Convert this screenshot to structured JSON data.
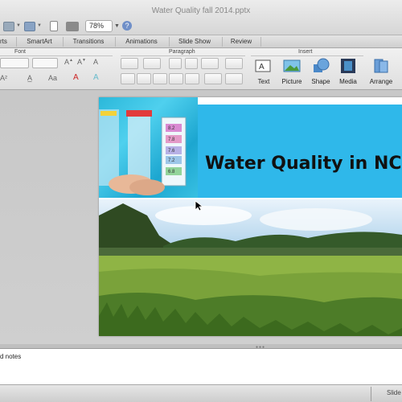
{
  "window": {
    "title": "Water Quality fall 2014.pptx",
    "zoom": "78%"
  },
  "ribbon_tabs": [
    "rts",
    "SmartArt",
    "Transitions",
    "Animations",
    "Slide Show",
    "Review"
  ],
  "ribbon_groups": {
    "font": "Font",
    "paragraph": "Paragraph",
    "insert": "Insert"
  },
  "ribbon_buttons": {
    "text": "Text",
    "picture": "Picture",
    "shape": "Shape",
    "media": "Media",
    "arrange": "Arrange"
  },
  "slide": {
    "title": "Water Quality in NC"
  },
  "test_strip_values": [
    "8.2",
    "7.8",
    "7.6",
    "7.2",
    "6.8"
  ],
  "notes": {
    "text": "d notes"
  },
  "status": {
    "view_label": "Slide"
  },
  "icons": [
    "open-icon",
    "save-icon",
    "print-icon",
    "help-icon",
    "text-box-icon",
    "picture-icon",
    "shape-icon",
    "media-icon",
    "arrange-icon"
  ],
  "colors": {
    "title_band": "#2fb8ea",
    "ribbon": "#e4e4e4",
    "workspace": "#cccccc"
  }
}
